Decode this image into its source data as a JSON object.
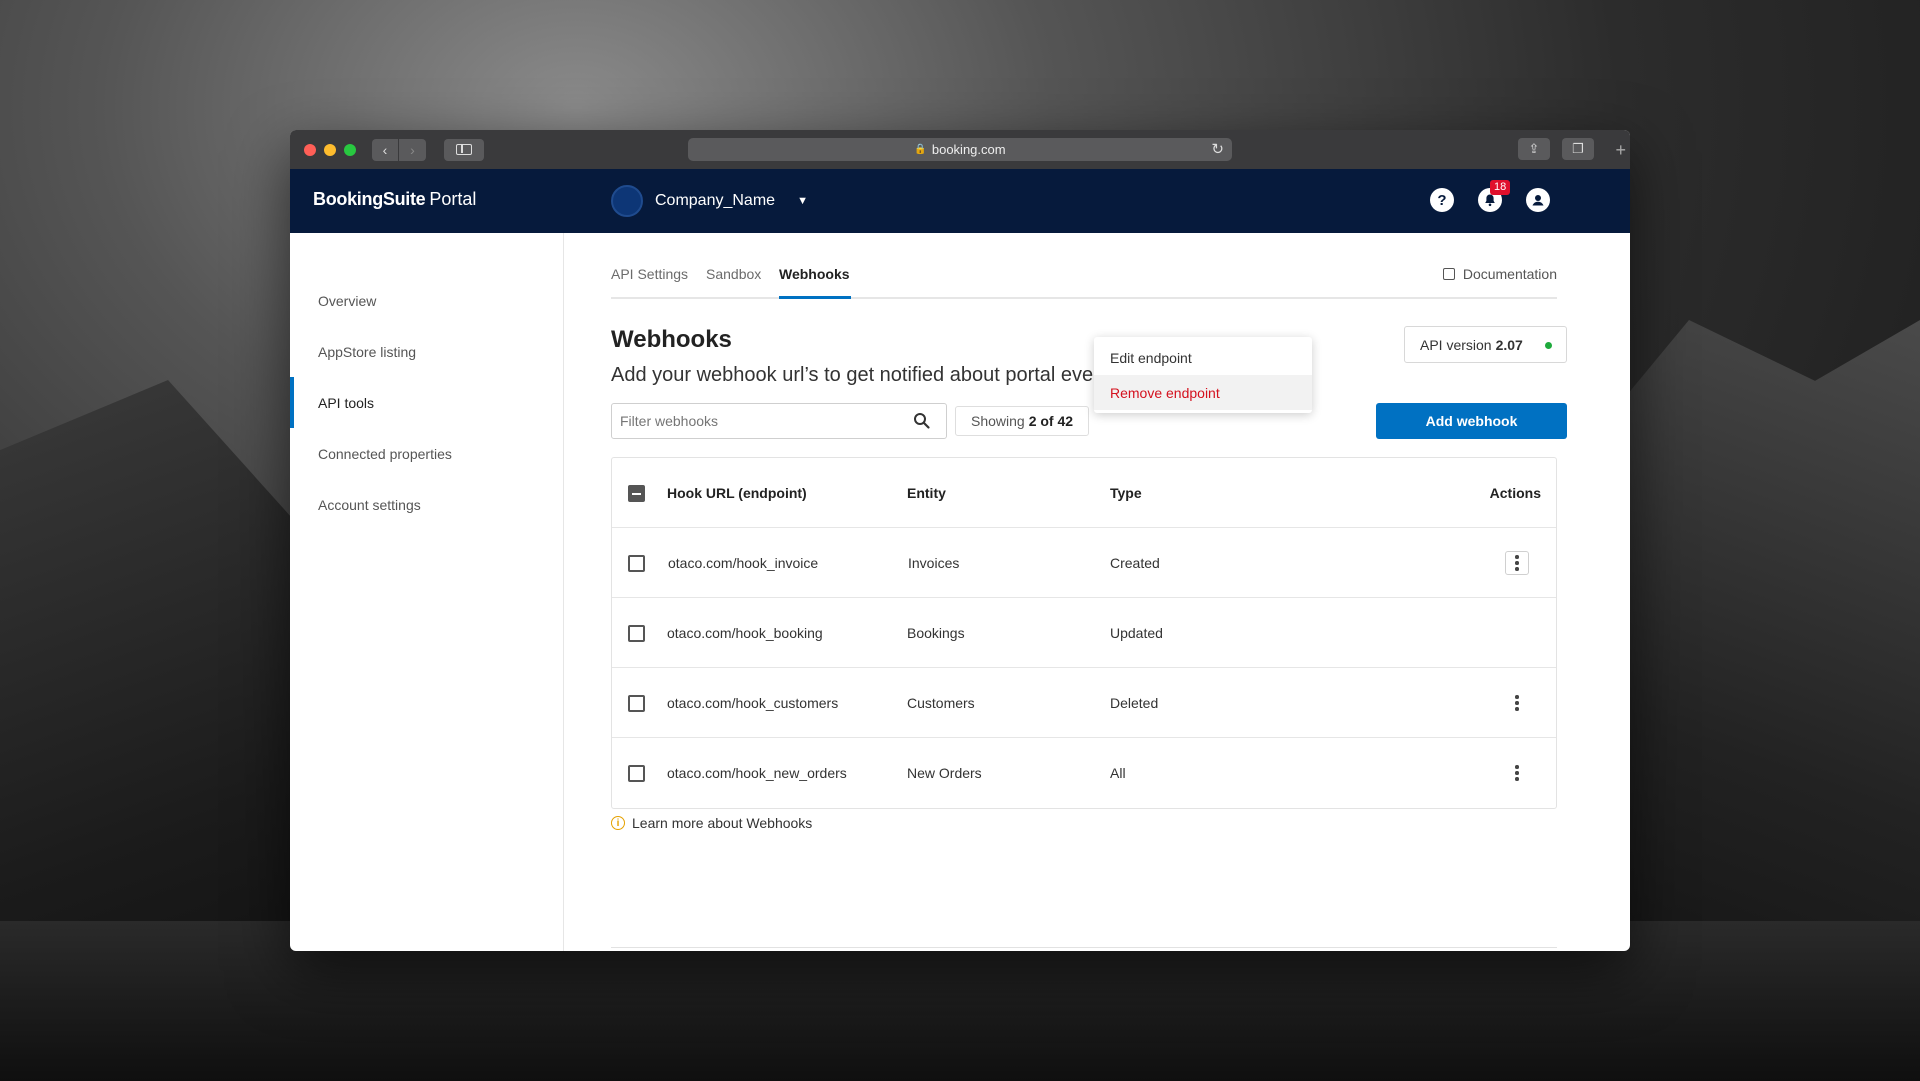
{
  "browser": {
    "url": "booking.com",
    "traffic_colors": [
      "#ff5f57",
      "#febc2e",
      "#28c840"
    ]
  },
  "appbar": {
    "brand_bold": "BookingSuite",
    "brand_light": "Portal",
    "company": "Company_Name",
    "notifications_count": "18",
    "colors": {
      "appbar_bg": "#061a3c",
      "accent": "#0071c2"
    }
  },
  "sidebar": {
    "items": [
      {
        "label": "Overview",
        "active": false
      },
      {
        "label": "AppStore listing",
        "active": false
      },
      {
        "label": "API tools",
        "active": true
      },
      {
        "label": "Connected properties",
        "active": false
      },
      {
        "label": "Account settings",
        "active": false
      }
    ]
  },
  "tabs": {
    "items": [
      {
        "label": "API Settings",
        "active": false
      },
      {
        "label": "Sandbox",
        "active": false
      },
      {
        "label": "Webhooks",
        "active": true
      }
    ],
    "documentation": "Documentation"
  },
  "page": {
    "title": "Webhooks",
    "subtitle": "Add your webhook url’s to get notified about portal events",
    "api_version_label": "API version",
    "api_version_value": "2.07"
  },
  "toolbar": {
    "filter_placeholder": "Filter webhooks",
    "showing_prefix": "Showing",
    "showing_value": "2 of 42",
    "add_button": "Add webhook"
  },
  "table": {
    "headers": {
      "url": "Hook URL (endpoint)",
      "entity": "Entity",
      "type": "Type",
      "actions": "Actions"
    },
    "rows": [
      {
        "url": "otaco.com/hook_invoice",
        "entity": "Invoices",
        "type": "Created"
      },
      {
        "url": "otaco.com/hook_booking",
        "entity": "Bookings",
        "type": "Updated"
      },
      {
        "url": "otaco.com/hook_customers",
        "entity": "Customers",
        "type": "Deleted"
      },
      {
        "url": "otaco.com/hook_new_orders",
        "entity": "New Orders",
        "type": "All"
      }
    ]
  },
  "menu": {
    "edit": "Edit endpoint",
    "remove": "Remove endpoint"
  },
  "footer": {
    "learn_more": "Learn more about Webhooks"
  }
}
